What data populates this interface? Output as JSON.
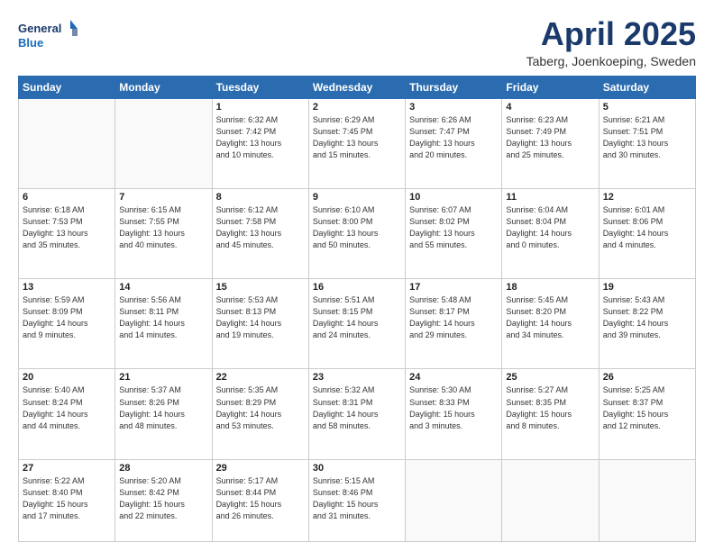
{
  "header": {
    "logo_line1": "General",
    "logo_line2": "Blue",
    "month": "April 2025",
    "location": "Taberg, Joenkoeping, Sweden"
  },
  "weekdays": [
    "Sunday",
    "Monday",
    "Tuesday",
    "Wednesday",
    "Thursday",
    "Friday",
    "Saturday"
  ],
  "weeks": [
    [
      {
        "day": "",
        "info": ""
      },
      {
        "day": "",
        "info": ""
      },
      {
        "day": "1",
        "info": "Sunrise: 6:32 AM\nSunset: 7:42 PM\nDaylight: 13 hours\nand 10 minutes."
      },
      {
        "day": "2",
        "info": "Sunrise: 6:29 AM\nSunset: 7:45 PM\nDaylight: 13 hours\nand 15 minutes."
      },
      {
        "day": "3",
        "info": "Sunrise: 6:26 AM\nSunset: 7:47 PM\nDaylight: 13 hours\nand 20 minutes."
      },
      {
        "day": "4",
        "info": "Sunrise: 6:23 AM\nSunset: 7:49 PM\nDaylight: 13 hours\nand 25 minutes."
      },
      {
        "day": "5",
        "info": "Sunrise: 6:21 AM\nSunset: 7:51 PM\nDaylight: 13 hours\nand 30 minutes."
      }
    ],
    [
      {
        "day": "6",
        "info": "Sunrise: 6:18 AM\nSunset: 7:53 PM\nDaylight: 13 hours\nand 35 minutes."
      },
      {
        "day": "7",
        "info": "Sunrise: 6:15 AM\nSunset: 7:55 PM\nDaylight: 13 hours\nand 40 minutes."
      },
      {
        "day": "8",
        "info": "Sunrise: 6:12 AM\nSunset: 7:58 PM\nDaylight: 13 hours\nand 45 minutes."
      },
      {
        "day": "9",
        "info": "Sunrise: 6:10 AM\nSunset: 8:00 PM\nDaylight: 13 hours\nand 50 minutes."
      },
      {
        "day": "10",
        "info": "Sunrise: 6:07 AM\nSunset: 8:02 PM\nDaylight: 13 hours\nand 55 minutes."
      },
      {
        "day": "11",
        "info": "Sunrise: 6:04 AM\nSunset: 8:04 PM\nDaylight: 14 hours\nand 0 minutes."
      },
      {
        "day": "12",
        "info": "Sunrise: 6:01 AM\nSunset: 8:06 PM\nDaylight: 14 hours\nand 4 minutes."
      }
    ],
    [
      {
        "day": "13",
        "info": "Sunrise: 5:59 AM\nSunset: 8:09 PM\nDaylight: 14 hours\nand 9 minutes."
      },
      {
        "day": "14",
        "info": "Sunrise: 5:56 AM\nSunset: 8:11 PM\nDaylight: 14 hours\nand 14 minutes."
      },
      {
        "day": "15",
        "info": "Sunrise: 5:53 AM\nSunset: 8:13 PM\nDaylight: 14 hours\nand 19 minutes."
      },
      {
        "day": "16",
        "info": "Sunrise: 5:51 AM\nSunset: 8:15 PM\nDaylight: 14 hours\nand 24 minutes."
      },
      {
        "day": "17",
        "info": "Sunrise: 5:48 AM\nSunset: 8:17 PM\nDaylight: 14 hours\nand 29 minutes."
      },
      {
        "day": "18",
        "info": "Sunrise: 5:45 AM\nSunset: 8:20 PM\nDaylight: 14 hours\nand 34 minutes."
      },
      {
        "day": "19",
        "info": "Sunrise: 5:43 AM\nSunset: 8:22 PM\nDaylight: 14 hours\nand 39 minutes."
      }
    ],
    [
      {
        "day": "20",
        "info": "Sunrise: 5:40 AM\nSunset: 8:24 PM\nDaylight: 14 hours\nand 44 minutes."
      },
      {
        "day": "21",
        "info": "Sunrise: 5:37 AM\nSunset: 8:26 PM\nDaylight: 14 hours\nand 48 minutes."
      },
      {
        "day": "22",
        "info": "Sunrise: 5:35 AM\nSunset: 8:29 PM\nDaylight: 14 hours\nand 53 minutes."
      },
      {
        "day": "23",
        "info": "Sunrise: 5:32 AM\nSunset: 8:31 PM\nDaylight: 14 hours\nand 58 minutes."
      },
      {
        "day": "24",
        "info": "Sunrise: 5:30 AM\nSunset: 8:33 PM\nDaylight: 15 hours\nand 3 minutes."
      },
      {
        "day": "25",
        "info": "Sunrise: 5:27 AM\nSunset: 8:35 PM\nDaylight: 15 hours\nand 8 minutes."
      },
      {
        "day": "26",
        "info": "Sunrise: 5:25 AM\nSunset: 8:37 PM\nDaylight: 15 hours\nand 12 minutes."
      }
    ],
    [
      {
        "day": "27",
        "info": "Sunrise: 5:22 AM\nSunset: 8:40 PM\nDaylight: 15 hours\nand 17 minutes."
      },
      {
        "day": "28",
        "info": "Sunrise: 5:20 AM\nSunset: 8:42 PM\nDaylight: 15 hours\nand 22 minutes."
      },
      {
        "day": "29",
        "info": "Sunrise: 5:17 AM\nSunset: 8:44 PM\nDaylight: 15 hours\nand 26 minutes."
      },
      {
        "day": "30",
        "info": "Sunrise: 5:15 AM\nSunset: 8:46 PM\nDaylight: 15 hours\nand 31 minutes."
      },
      {
        "day": "",
        "info": ""
      },
      {
        "day": "",
        "info": ""
      },
      {
        "day": "",
        "info": ""
      }
    ]
  ]
}
